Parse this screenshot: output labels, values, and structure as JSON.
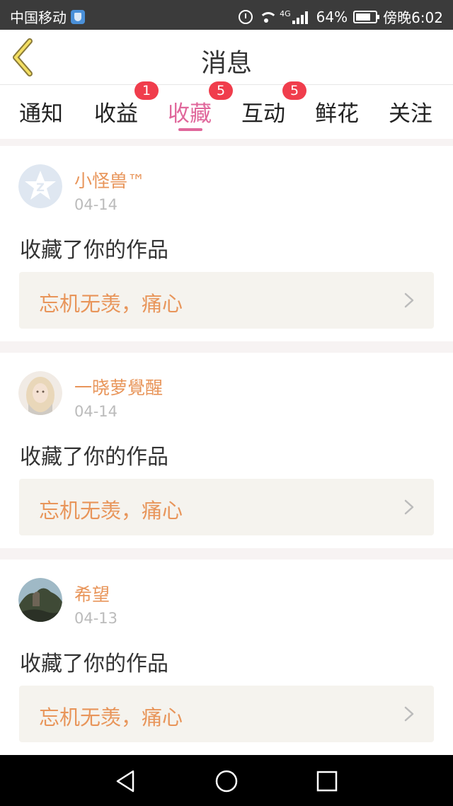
{
  "status_bar": {
    "carrier": "中国移动",
    "network": "4G",
    "battery": "64%",
    "time": "傍晚6:02"
  },
  "header": {
    "title": "消息"
  },
  "tabs": [
    {
      "label": "通知",
      "badge": ""
    },
    {
      "label": "收益",
      "badge": "1"
    },
    {
      "label": "收藏",
      "badge": "5",
      "active": true
    },
    {
      "label": "互动",
      "badge": "5"
    },
    {
      "label": "鲜花",
      "badge": ""
    },
    {
      "label": "关注",
      "badge": ""
    }
  ],
  "items": [
    {
      "user": "小怪兽™",
      "date": "04-14",
      "action": "收藏了你的作品",
      "work": "忘机无羡，痛心",
      "avatar": "q-default-avatar"
    },
    {
      "user": "一晓萝覺醒",
      "date": "04-14",
      "action": "收藏了你的作品",
      "work": "忘机无羡，痛心",
      "avatar": "girl-photo-avatar"
    },
    {
      "user": "希望",
      "date": "04-13",
      "action": "收藏了你的作品",
      "work": "忘机无羡，痛心",
      "avatar": "landscape-photo-avatar"
    }
  ],
  "colors": {
    "accent": "#e0679b",
    "username": "#e8955a",
    "badge": "#f03d4c"
  }
}
